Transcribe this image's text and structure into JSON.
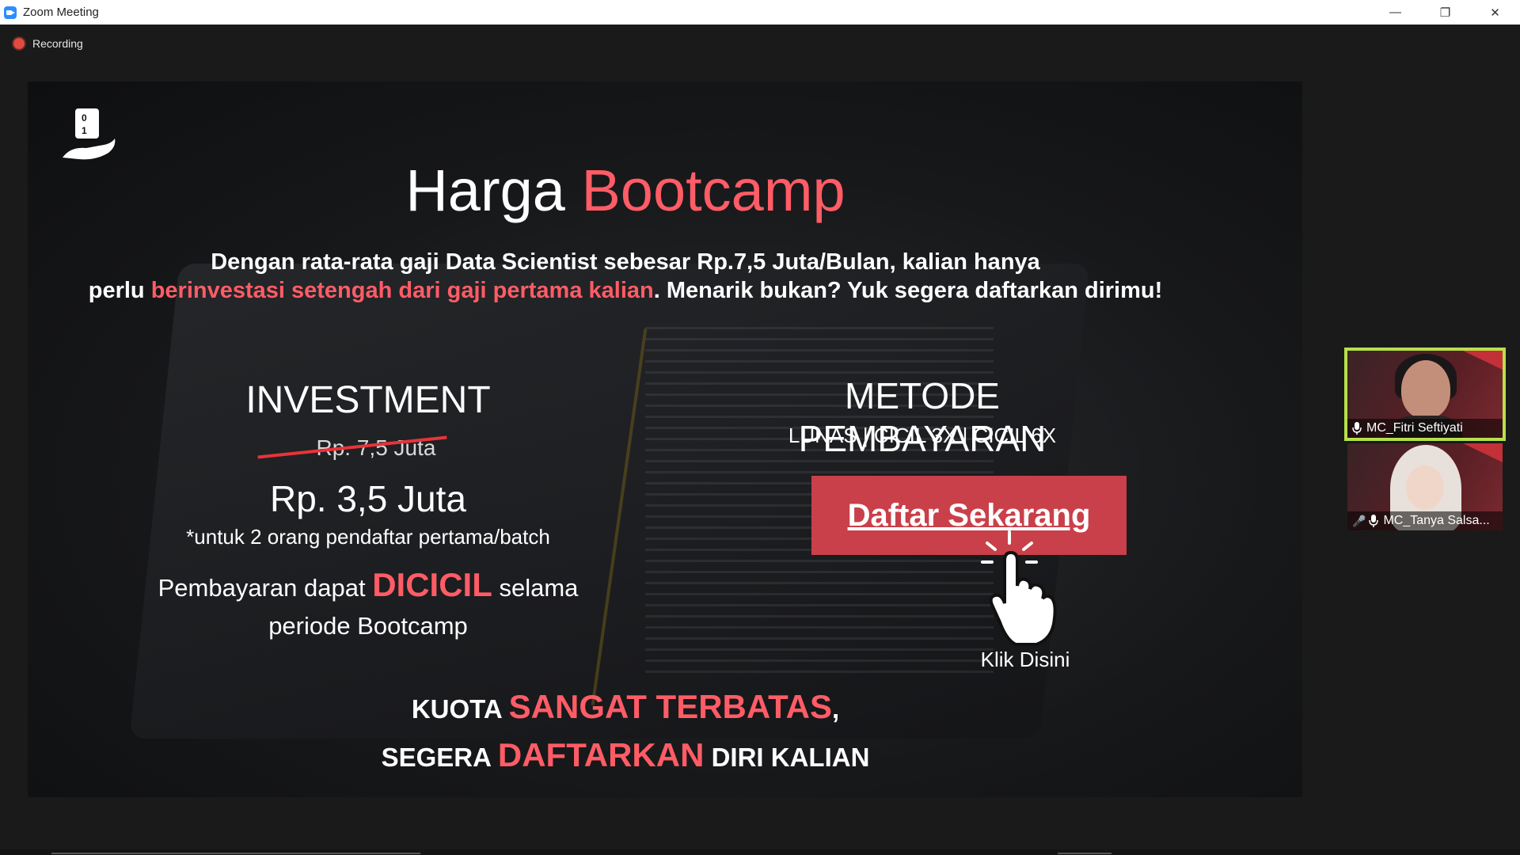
{
  "window": {
    "title": "Zoom Meeting",
    "minimize": "—",
    "restore": "❐",
    "close": "✕"
  },
  "recording": {
    "label": "Recording"
  },
  "slide": {
    "headline_white": "Harga ",
    "headline_accent": "Bootcamp",
    "intro_line1": "Dengan rata-rata gaji Data Scientist sebesar Rp.7,5 Juta/Bulan, kalian hanya",
    "intro_line2_start": "perlu ",
    "intro_line2_accent": "berinvestasi setengah dari gaji pertama kalian",
    "intro_line2_end": ". Menarik bukan? Yuk segera daftarkan dirimu!",
    "investment_title": "INVESTMENT",
    "old_price": "Rp. 7,5 Juta",
    "new_price": "Rp. 3,5 Juta",
    "note": "*untuk 2 orang pendaftar pertama/batch",
    "installment_start": "Pembayaran dapat ",
    "installment_accent": "DICICIL",
    "installment_mid": " selama",
    "installment_line2": "periode Bootcamp",
    "metode_title": "METODE PEMBAYARAN",
    "metode_options": "LUNAS | CICIL 3X | CICIL 6X",
    "cta_label": "Daftar Sekarang",
    "klik_label": "Klik Disini",
    "kuota_line1_start": "KUOTA ",
    "kuota_line1_accent": "SANGAT TERBATAS",
    "kuota_line1_end": ",",
    "kuota_line2_start": "SEGERA ",
    "kuota_line2_accent": "DAFTARKAN",
    "kuota_line2_end": " DIRI KALIAN",
    "accent_color": "#ff5c66",
    "cta_color": "#c9404a"
  },
  "participants": [
    {
      "name": "MC_Fitri Seftiyati",
      "active": true,
      "muted": false,
      "icon": "mic-icon"
    },
    {
      "name": "MC_Tanya Salsa...",
      "active": false,
      "muted": true,
      "icon": "mic-muted-icon"
    }
  ]
}
